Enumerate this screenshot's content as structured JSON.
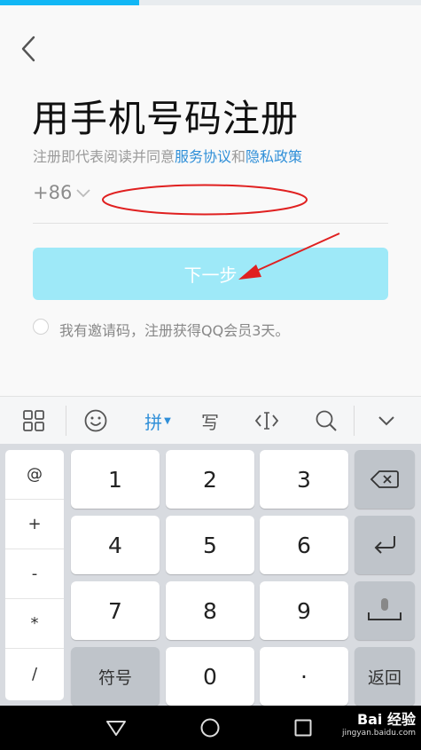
{
  "progress": {
    "fraction": 0.33,
    "color": "#12b7f5"
  },
  "header": {
    "back_icon": "chevron-left-icon"
  },
  "page": {
    "title": "用手机号码注册",
    "agreement_prefix": "注册即代表阅读并同意",
    "service_link": "服务协议",
    "agreement_and": "和",
    "privacy_link": "隐私政策"
  },
  "phone": {
    "country_code": "+86",
    "value": "",
    "placeholder": ""
  },
  "next_button": {
    "label": "下一步",
    "color": "#9ee9f8"
  },
  "invite": {
    "label": "我有邀请码，注册获得QQ会员3天。",
    "checked": false
  },
  "annotations": {
    "ellipse_color": "#e02020",
    "arrow_color": "#e02020"
  },
  "keyboard": {
    "toolbar": {
      "items": [
        "grid-icon",
        "emoji-icon",
        "拼",
        "写",
        "cursor-icon",
        "search-icon",
        "chevron-down-icon"
      ],
      "active_index": 2
    },
    "symbols": [
      "@",
      "+",
      "-",
      "*",
      "/"
    ],
    "digits": [
      "1",
      "2",
      "3",
      "4",
      "5",
      "6",
      "7",
      "8",
      "9"
    ],
    "symbol_key": "符号",
    "zero": "0",
    "dot": "·",
    "back_key": "返回",
    "side_icons": [
      "backspace-icon",
      "enter-icon",
      "space-icon"
    ]
  },
  "nav": {
    "buttons": [
      "back-triangle-icon",
      "home-circle-icon",
      "recents-square-icon"
    ]
  },
  "watermark": {
    "brand": "Bai 经验",
    "url": "jingyan.baidu.com"
  }
}
